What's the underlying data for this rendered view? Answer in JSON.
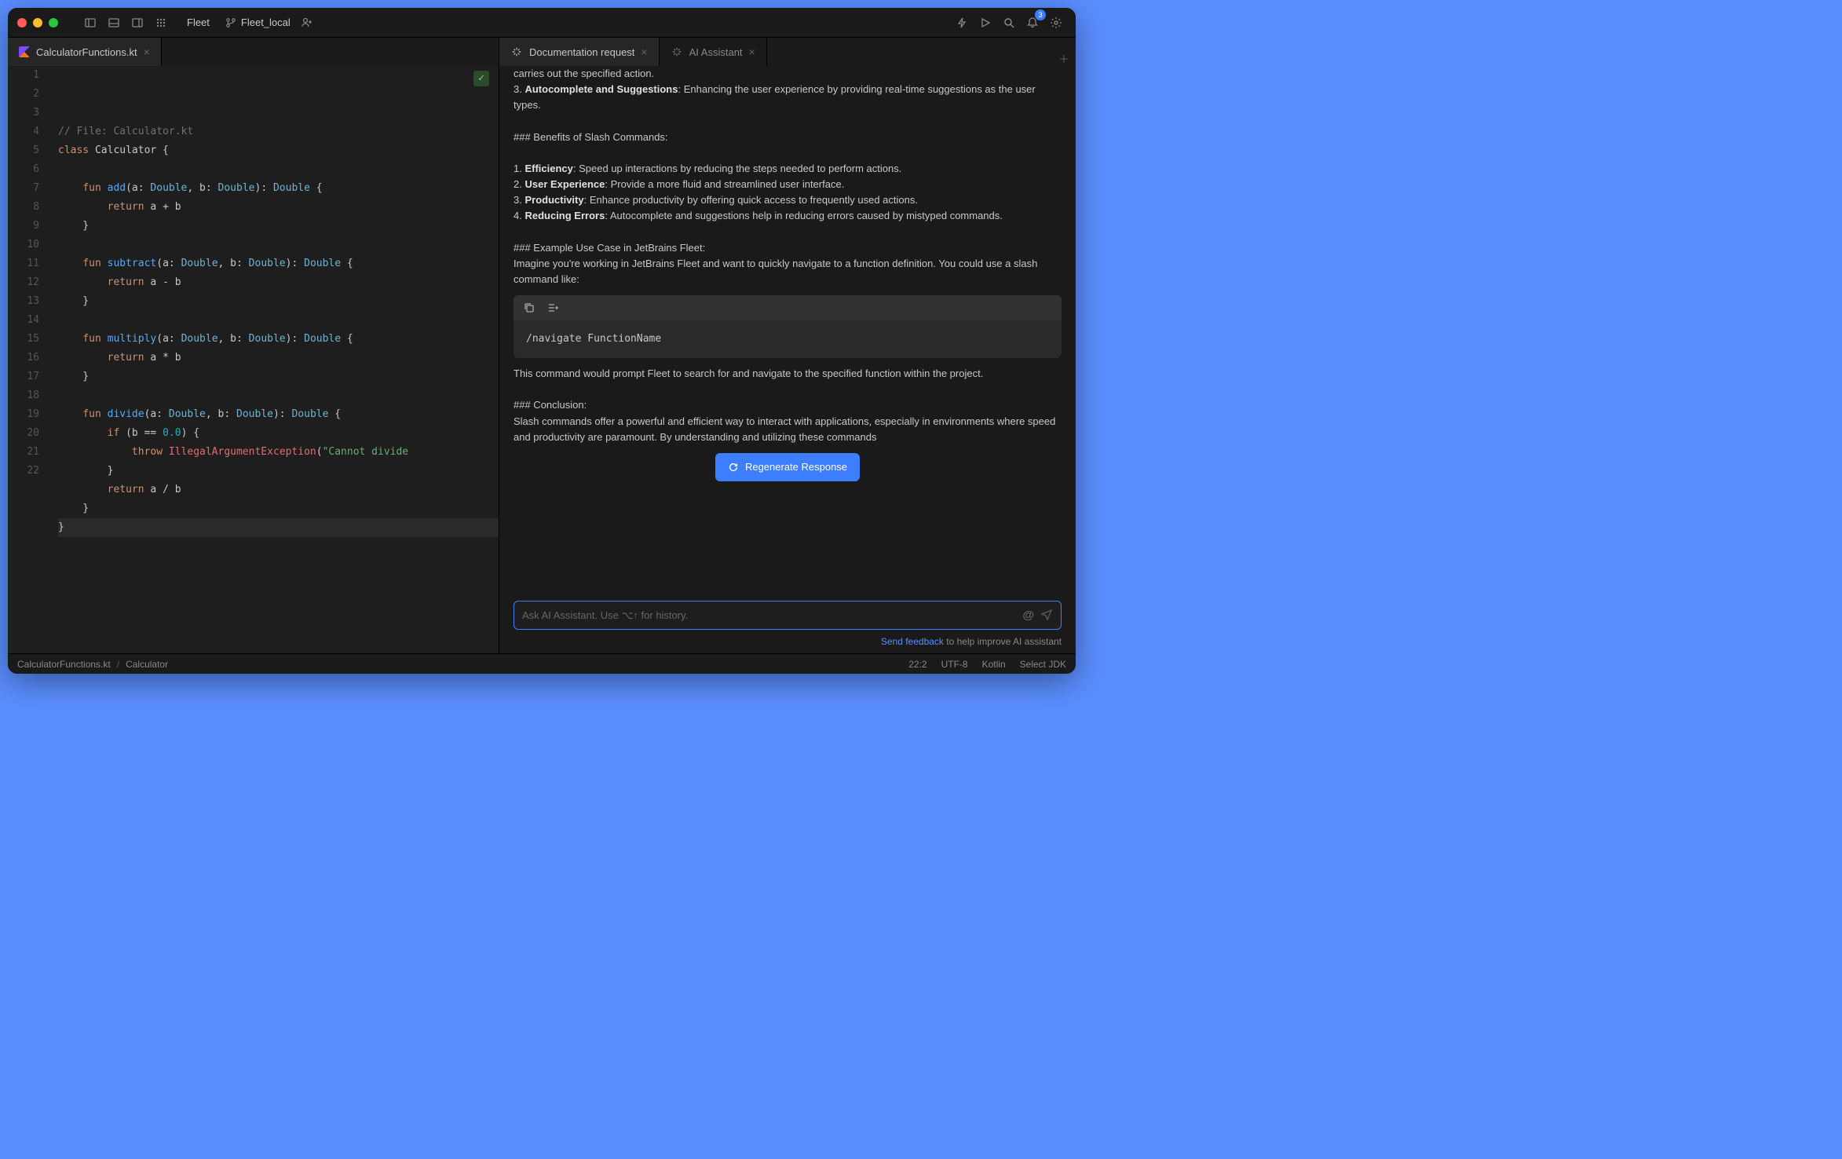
{
  "titlebar": {
    "app": "Fleet",
    "branch": "Fleet_local",
    "notifications": "3"
  },
  "leftTab": {
    "filename": "CalculatorFunctions.kt"
  },
  "editor": {
    "lines": [
      {
        "n": 1,
        "html": "<span class='hl-comment'>// File: Calculator.kt</span>"
      },
      {
        "n": 2,
        "html": "<span class='hl-kw'>class</span> Calculator {"
      },
      {
        "n": 3,
        "html": ""
      },
      {
        "n": 4,
        "html": "    <span class='hl-kw'>fun</span> <span class='hl-fn'>add</span>(a: <span class='hl-type'>Double</span>, b: <span class='hl-type'>Double</span>): <span class='hl-type'>Double</span> {"
      },
      {
        "n": 5,
        "html": "        <span class='hl-kw'>return</span> a + b"
      },
      {
        "n": 6,
        "html": "    }"
      },
      {
        "n": 7,
        "html": ""
      },
      {
        "n": 8,
        "html": "    <span class='hl-kw'>fun</span> <span class='hl-fn'>subtract</span>(a: <span class='hl-type'>Double</span>, b: <span class='hl-type'>Double</span>): <span class='hl-type'>Double</span> {"
      },
      {
        "n": 9,
        "html": "        <span class='hl-kw'>return</span> a - b"
      },
      {
        "n": 10,
        "html": "    }"
      },
      {
        "n": 11,
        "html": ""
      },
      {
        "n": 12,
        "html": "    <span class='hl-kw'>fun</span> <span class='hl-fn'>multiply</span>(a: <span class='hl-type'>Double</span>, b: <span class='hl-type'>Double</span>): <span class='hl-type'>Double</span> {"
      },
      {
        "n": 13,
        "html": "        <span class='hl-kw'>return</span> a * b"
      },
      {
        "n": 14,
        "html": "    }"
      },
      {
        "n": 15,
        "html": ""
      },
      {
        "n": 16,
        "html": "    <span class='hl-kw'>fun</span> <span class='hl-fn'>divide</span>(a: <span class='hl-type'>Double</span>, b: <span class='hl-type'>Double</span>): <span class='hl-type'>Double</span> {"
      },
      {
        "n": 17,
        "html": "        <span class='hl-kw'>if</span> (b == <span class='hl-num'>0.0</span>) {"
      },
      {
        "n": 18,
        "html": "            <span class='hl-kw'>throw</span> <span class='hl-err'>IllegalArgumentException</span>(<span class='hl-str'>\"Cannot divide</span>"
      },
      {
        "n": 19,
        "html": "        }"
      },
      {
        "n": 20,
        "html": "        <span class='hl-kw'>return</span> a / b"
      },
      {
        "n": 21,
        "html": "    }"
      },
      {
        "n": 22,
        "html": "}",
        "cursor": true
      }
    ]
  },
  "rightTabs": [
    {
      "label": "Documentation request",
      "active": true
    },
    {
      "label": "AI Assistant",
      "active": false
    }
  ],
  "ai": {
    "p0": "carries out the specified action.",
    "l3n": "3. ",
    "l3b": "Autocomplete and Suggestions",
    "l3t": ": Enhancing the user experience by providing real-time suggestions as the user types.",
    "h1": "### Benefits of Slash Commands:",
    "b1n": "1. ",
    "b1b": "Efficiency",
    "b1t": ": Speed up interactions by reducing the steps needed to perform actions.",
    "b2n": "2. ",
    "b2b": "User Experience",
    "b2t": ": Provide a more fluid and streamlined user interface.",
    "b3n": "3. ",
    "b3b": "Productivity",
    "b3t": ": Enhance productivity by offering quick access to frequently used actions.",
    "b4n": "4. ",
    "b4b": "Reducing Errors",
    "b4t": ": Autocomplete and suggestions help in reducing errors caused by mistyped commands.",
    "h2": "### Example Use Case in JetBrains Fleet:",
    "p1": "Imagine you're working in JetBrains Fleet and want to quickly navigate to a function definition. You could use a slash command like:",
    "code": "/navigate FunctionName",
    "p2": "This command would prompt Fleet to search for and navigate to the specified function within the project.",
    "h3": "### Conclusion:",
    "p3": "Slash commands offer a powerful and efficient way to interact with applications, especially in environments where speed and productivity are paramount. By understanding and utilizing these commands",
    "regen": "Regenerate Response",
    "placeholder": "Ask AI Assistant. Use ⌥↑ for history.",
    "feedback_link": "Send feedback",
    "feedback_rest": " to help improve AI assistant"
  },
  "status": {
    "path1": "CalculatorFunctions.kt",
    "path2": "Calculator",
    "pos": "22:2",
    "enc": "UTF-8",
    "lang": "Kotlin",
    "jdk": "Select JDK"
  }
}
